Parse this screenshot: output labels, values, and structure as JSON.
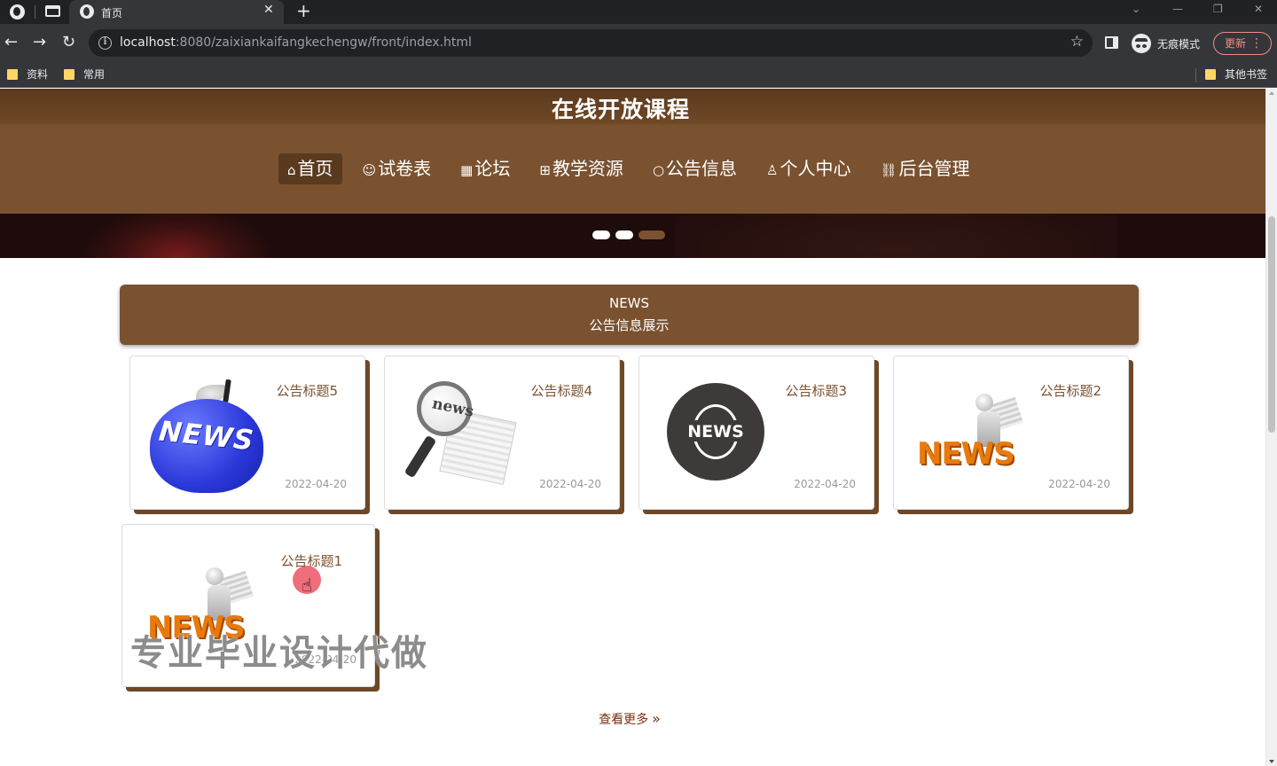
{
  "browser": {
    "tab_title": "首页",
    "url_host": "localhost",
    "url_rest": ":8080/zaixiankaifangkechengw/front/index.html",
    "incognito_label": "无痕模式",
    "update_label": "更新",
    "bookmarks": [
      "资料",
      "常用"
    ],
    "other_bookmarks": "其他书签"
  },
  "site": {
    "title": "在线开放课程",
    "menu": [
      {
        "label": "首页",
        "icon": "⌂",
        "active": true
      },
      {
        "label": "试卷表",
        "icon": "☺"
      },
      {
        "label": "论坛",
        "icon": "▦"
      },
      {
        "label": "教学资源",
        "icon": "⊞"
      },
      {
        "label": "公告信息",
        "icon": "○"
      },
      {
        "label": "个人中心",
        "icon": "♙"
      },
      {
        "label": "后台管理",
        "icon": "⛓"
      }
    ],
    "carousel_dots": 3
  },
  "news": {
    "heading_en": "NEWS",
    "heading_cn": "公告信息展示",
    "items": [
      {
        "title": "公告标题5",
        "date": "2022-04-20",
        "image": "apple-news-icon"
      },
      {
        "title": "公告标题4",
        "date": "2022-04-20",
        "image": "magnifier-news-icon"
      },
      {
        "title": "公告标题3",
        "date": "2022-04-20",
        "image": "globe-news-icon"
      },
      {
        "title": "公告标题2",
        "date": "2022-04-20",
        "image": "reader-news-icon"
      },
      {
        "title": "公告标题1",
        "date": "2022-04-20",
        "image": "reader-news-icon"
      }
    ],
    "more_label": "查看更多",
    "image_texts": {
      "apple": "NEWS",
      "magnifier": "news",
      "globe": "NEWS",
      "reader": "NEWS"
    }
  },
  "overlay": {
    "watermark": "专业毕业设计代做"
  },
  "colors": {
    "brand": "#7a5230",
    "brand_dark": "#5a3a1e"
  }
}
